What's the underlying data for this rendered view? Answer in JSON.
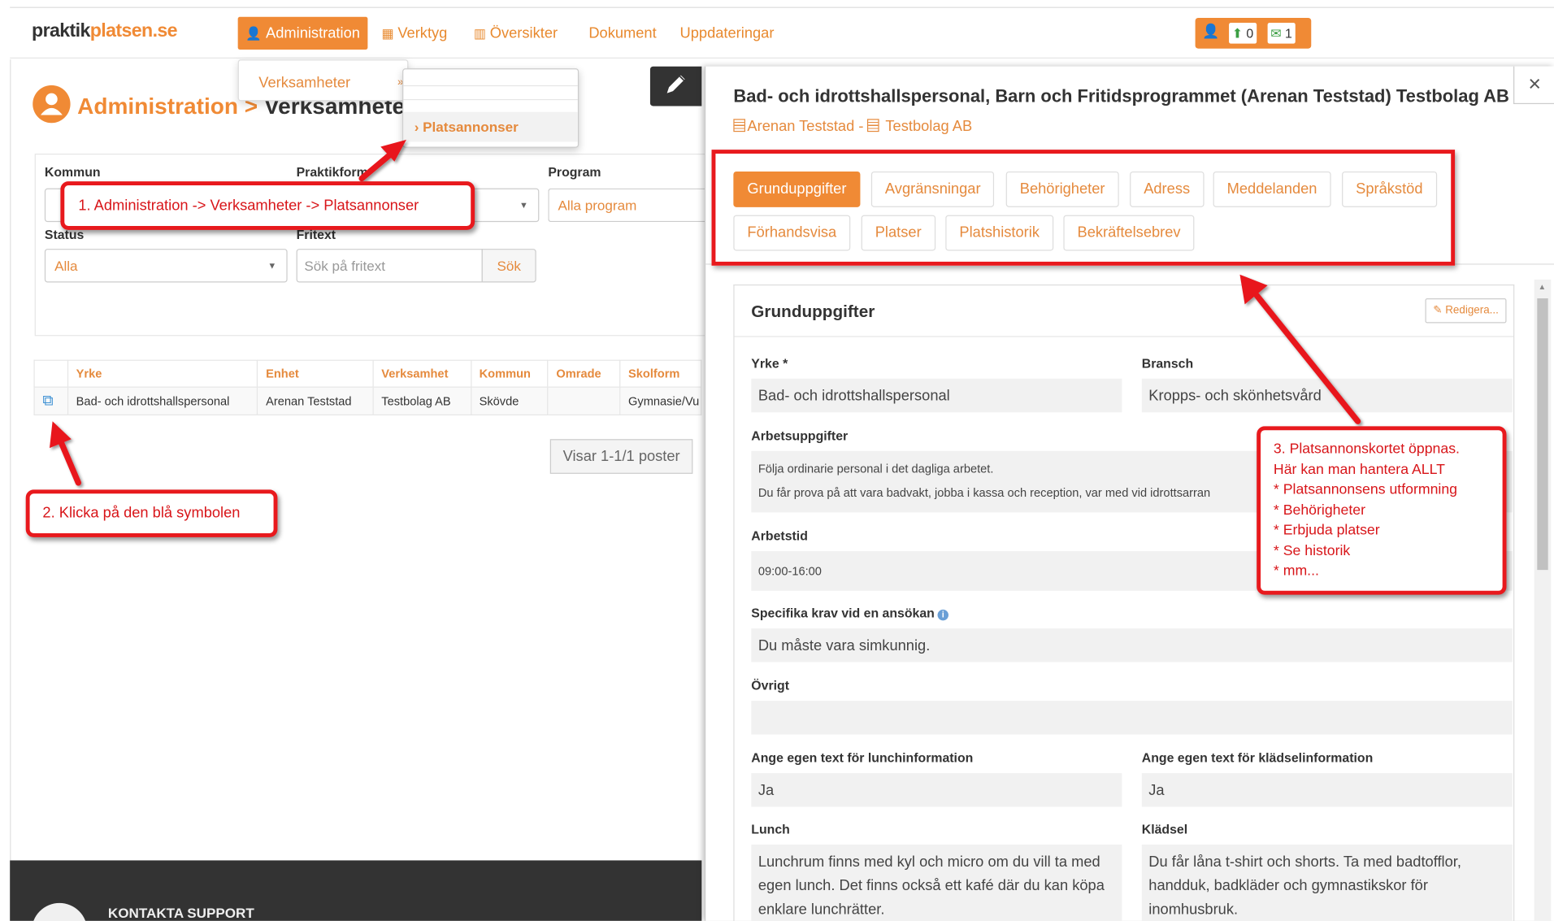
{
  "navbar": {
    "logo_a": "praktik",
    "logo_b": "platsen.se",
    "items": [
      "Administration",
      "Verktyg",
      "Översikter",
      "Dokument",
      "Uppdateringar"
    ],
    "badges": [
      "0",
      "1"
    ]
  },
  "page": {
    "title": "Administration",
    "title_sep": " > ",
    "breadcrumb": "Verksamheter",
    "dropdown_item": "Verksamheter",
    "dropdown_arrow": "»",
    "submenu_item": "› Platsannonser"
  },
  "filters": {
    "kommun_label": "Kommun",
    "praktikform_label": "Praktikform",
    "program_label": "Program",
    "program_value": "Alla program",
    "status_label": "Status",
    "status_value": "Alla",
    "fritext_label": "Fritext",
    "fritext_placeholder": "Sök på fritext",
    "search_button": "Sök",
    "caret": "▼"
  },
  "table": {
    "headers": [
      "Yrke",
      "Enhet",
      "Verksamhet",
      "Kommun",
      "Omrade",
      "Skolform"
    ],
    "rows": [
      [
        "Bad- och idrottshallspersonal",
        "Arenan Teststad",
        "Testbolag AB",
        "Skövde",
        "",
        "Gymnasie/Vu"
      ]
    ],
    "pager": "Visar 1-1/1 poster"
  },
  "footer": {
    "text": "KONTAKTA SUPPORT"
  },
  "panel": {
    "title": "Bad- och idrottshallspersonal, Barn och Fritidsprogrammet (Arenan Teststad) Testbolag AB",
    "sub_unit": "Arenan Teststad",
    "sub_sep": " - ",
    "sub_company": "Testbolag AB",
    "close": "×",
    "tabs": [
      "Grunduppgifter",
      "Avgränsningar",
      "Behörigheter",
      "Adress",
      "Meddelanden",
      "Språkstöd",
      "Förhandsvisa",
      "Platser",
      "Platshistorik",
      "Bekräftelsebrev"
    ],
    "card_title": "Grunduppgifter",
    "edit_button": "Redigera...",
    "fields": {
      "yrke_label": "Yrke *",
      "yrke_value": "Bad- och idrottshallspersonal",
      "bransch_label": "Bransch",
      "bransch_value": "Kropps- och skönhetsvård",
      "arbetsuppgifter_label": "Arbetsuppgifter",
      "arbetsuppgifter_line1": "Följa ordinarie personal i det dagliga arbetet.",
      "arbetsuppgifter_line2": "Du får prova på att vara badvakt, jobba i kassa och reception, var med vid idrottsarran",
      "arbetstid_label": "Arbetstid",
      "arbetstid_value": "09:00-16:00",
      "krav_label": "Specifika krav vid en ansökan",
      "krav_value": "Du måste vara simkunnig.",
      "ovrigt_label": "Övrigt",
      "ovrigt_value": "",
      "lunchinfo_label": "Ange egen text för lunchinformation",
      "lunchinfo_value": "Ja",
      "kladinfo_label": "Ange egen text för klädselinformation",
      "kladinfo_value": "Ja",
      "lunch_label": "Lunch",
      "lunch_value": "Lunchrum finns med kyl och micro om du vill ta med egen lunch. Det finns också ett kafé där du kan köpa enklare lunchrätter.",
      "kladsel_label": "Klädsel",
      "kladsel_value": "Du får låna t-shirt och shorts. Ta med badtofflor, handduk, badkläder och gymnastikskor för inomhusbruk."
    }
  },
  "annotations": {
    "step1": "1. Administration -> Verksamheter -> Platsannonser",
    "step2": "2. Klicka på den blå symbolen",
    "step3_lines": [
      "3. Platsannonskortet öppnas.",
      "Här kan man hantera ALLT",
      "* Platsannonsens utformning",
      "* Behörigheter",
      "* Erbjuda platser",
      "* Se historik",
      "* mm..."
    ]
  },
  "colors": {
    "brand_orange": "#f08a35",
    "annotation_red": "#e8191d",
    "link_blue": "#3b8fd3"
  }
}
